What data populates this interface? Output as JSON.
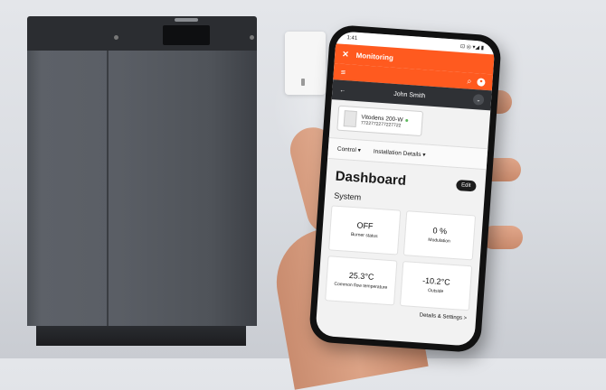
{
  "phone": {
    "status_time": "1:41",
    "status_icons": "⊡ ◎ ▾◢ ▮",
    "app_title": "Monitoring",
    "close_glyph": "✕",
    "menu_glyph": "≡",
    "search_glyph": "⌕",
    "user_glyph": "●",
    "back_glyph": "←",
    "user_name": "John Smith",
    "user_chevron": "⌄",
    "device": {
      "name": "Vitodens 200-W",
      "serial": "7722772277227722"
    },
    "tabs": [
      {
        "label": "Control ▾"
      },
      {
        "label": "Installation Details ▾"
      }
    ],
    "dashboard_title": "Dashboard",
    "edit_label": "Edit",
    "section_label": "System",
    "tiles": [
      {
        "value": "OFF",
        "label": "Burner status"
      },
      {
        "value": "0 %",
        "label": "Modulation"
      },
      {
        "value": "25.3°C",
        "label": "Common flow temperature"
      },
      {
        "value": "-10.2°C",
        "label": "Outside"
      }
    ],
    "details_label": "Details & Settings >"
  },
  "colors": {
    "accent": "#ff5a1f",
    "user_bar": "#2f3135"
  }
}
